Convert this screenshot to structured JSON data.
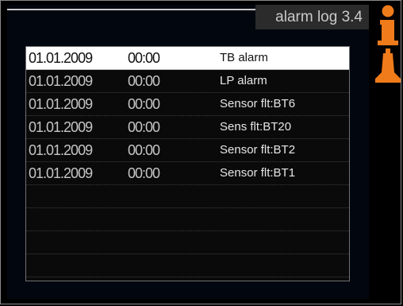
{
  "window": {
    "title": "alarm log 3.4"
  },
  "icons": {
    "info": "info-icon",
    "alarm": "alarm-bell-icon",
    "accent": "#f07b1a"
  },
  "log": {
    "rows": [
      {
        "date": "01.01.2009",
        "time": "00:00",
        "description": "TB alarm",
        "selected": true
      },
      {
        "date": "01.01.2009",
        "time": "00:00",
        "description": "LP alarm",
        "selected": false
      },
      {
        "date": "01.01.2009",
        "time": "00:00",
        "description": "Sensor flt:BT6",
        "selected": false
      },
      {
        "date": "01.01.2009",
        "time": "00:00",
        "description": "Sens flt:BT20",
        "selected": false
      },
      {
        "date": "01.01.2009",
        "time": "00:00",
        "description": "Sensor flt:BT2",
        "selected": false
      },
      {
        "date": "01.01.2009",
        "time": "00:00",
        "description": "Sensor flt:BT1",
        "selected": false
      }
    ],
    "empty_rows": 4
  }
}
